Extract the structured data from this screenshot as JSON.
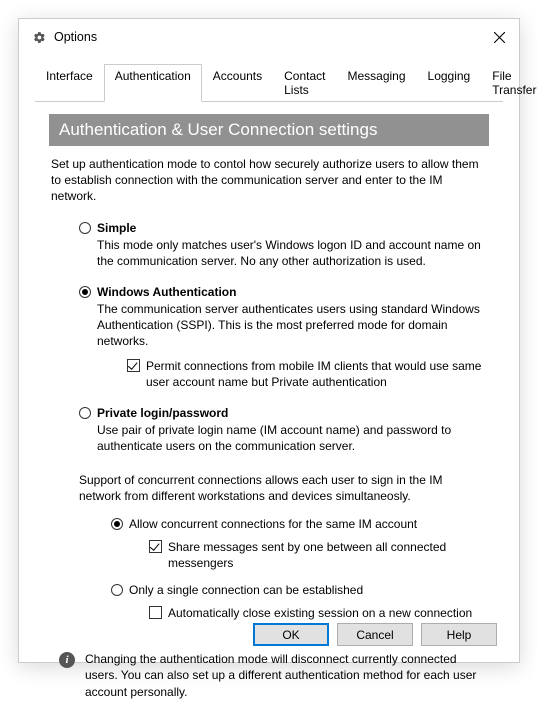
{
  "window": {
    "title": "Options"
  },
  "tabs": {
    "interface": "Interface",
    "authentication": "Authentication",
    "accounts": "Accounts",
    "contact_lists": "Contact Lists",
    "messaging": "Messaging",
    "logging": "Logging",
    "file_transfer": "File Transfer"
  },
  "section_title": "Authentication & User Connection settings",
  "intro": "Set up authentication mode to contol how securely authorize users to allow them to establish connection with the communication server and enter to the IM network.",
  "auth": {
    "simple": {
      "label": "Simple",
      "desc": "This mode only matches user's Windows logon ID and account name on the communication server. No any other authorization is used."
    },
    "windows": {
      "label": "Windows Authentication",
      "desc": "The communication server authenticates users using standard Windows Authentication (SSPI). This is the most preferred mode for domain networks.",
      "permit_mobile": "Permit connections from mobile IM clients that would use same user account name but Private authentication"
    },
    "private": {
      "label": "Private login/password",
      "desc": "Use pair of private login name (IM account name) and password to authenticate users on the communication server."
    }
  },
  "concurrent": {
    "intro": "Support of concurrent connections allows each user to sign in the IM network from different workstations and devices simultaneosly.",
    "allow": {
      "label": "Allow concurrent connections for the same IM account",
      "share": "Share messages sent by one between all connected messengers"
    },
    "single": {
      "label": "Only a single connection can be established",
      "auto_close": "Automatically close existing session on a new connection"
    }
  },
  "info": "Changing the authentication mode will disconnect currently connected users. You can also set up a different authentication method for each user account personally.",
  "buttons": {
    "ok": "OK",
    "cancel": "Cancel",
    "help": "Help"
  }
}
